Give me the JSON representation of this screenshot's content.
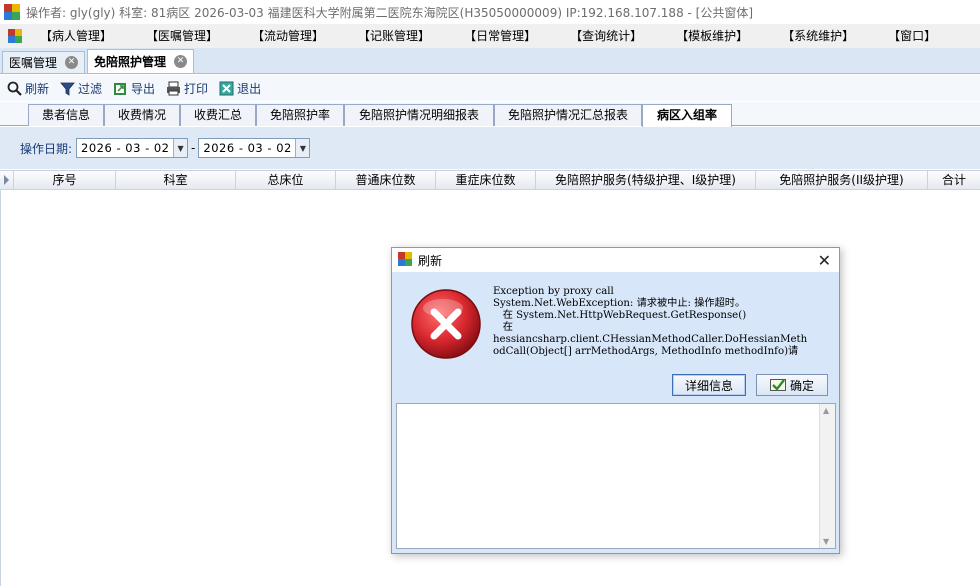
{
  "window": {
    "title": "操作者: gly(gly)  科室: 81病区  2026-03-03  福建医科大学附属第二医院东海院区(H35050000009) IP:192.168.107.188 - [公共窗体]"
  },
  "menubar": {
    "items": [
      "【病人管理】",
      "【医嘱管理】",
      "【流动管理】",
      "【记账管理】",
      "【日常管理】",
      "【查询统计】",
      "【模板维护】",
      "【系统维护】",
      "【窗口】"
    ]
  },
  "doc_tabs": [
    {
      "label": "医嘱管理",
      "active": false
    },
    {
      "label": "免陪照护管理",
      "active": true
    }
  ],
  "toolbar": {
    "refresh": "刷新",
    "filter": "过滤",
    "export": "导出",
    "print": "打印",
    "exit": "退出"
  },
  "sub_tabs": [
    "患者信息",
    "收费情况",
    "收费汇总",
    "免陪照护率",
    "免陪照护情况明细报表",
    "免陪照护情况汇总报表",
    "病区入组率"
  ],
  "active_sub_tab": "病区入组率",
  "filter": {
    "label": "操作日期:",
    "date_from": "2026 - 03 - 02",
    "separator": "-",
    "date_to": "2026 - 03 - 02"
  },
  "grid": {
    "columns": [
      "序号",
      "科室",
      "总床位",
      "普通床位数",
      "重症床位数",
      "免陪照护服务(特级护理、I级护理)",
      "免陪照护服务(II级护理)",
      "合计"
    ]
  },
  "dialog": {
    "title": "刷新",
    "message": "Exception by proxy call\nSystem.Net.WebException: 请求被中止: 操作超时。\n   在 System.Net.HttpWebRequest.GetResponse()\n   在\nhessiancsharp.client.CHessianMethodCaller.DoHessianMeth\nodCall(Object[] arrMethodArgs, MethodInfo methodInfo)请",
    "detail_button": "详细信息",
    "ok_button": "确定",
    "detail_text": ""
  },
  "colors": {
    "accent": "#1a3b75",
    "error_red": "#d9282f",
    "dialog_bg": "#d7e6f9"
  }
}
